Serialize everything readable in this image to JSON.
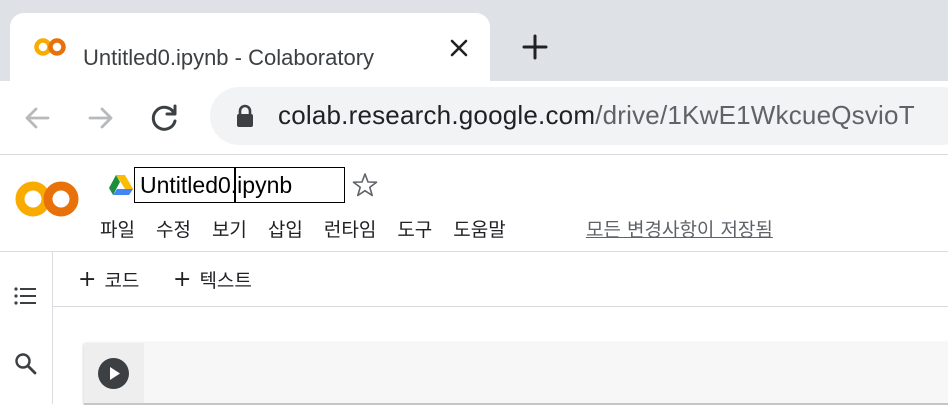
{
  "browser": {
    "tab": {
      "title": "Untitled0.ipynb - Colaboratory",
      "favicon": "colab-logo-icon"
    },
    "url": {
      "host": "colab.research.google.com",
      "path": "/drive/1KwE1WkcueQsvioT"
    }
  },
  "colab": {
    "notebook_title": "Untitled0.ipynb",
    "menu": [
      {
        "label": "파일"
      },
      {
        "label": "수정"
      },
      {
        "label": "보기"
      },
      {
        "label": "삽입"
      },
      {
        "label": "런타임"
      },
      {
        "label": "도구"
      },
      {
        "label": "도움말"
      }
    ],
    "save_status": "모든 변경사항이 저장됨",
    "toolbar": {
      "add_code": "코드",
      "add_text": "텍스트"
    }
  },
  "colors": {
    "colab_orange": "#f9ab00",
    "colab_dark_orange": "#e8710a",
    "tab_strip": "#dee1e6"
  }
}
